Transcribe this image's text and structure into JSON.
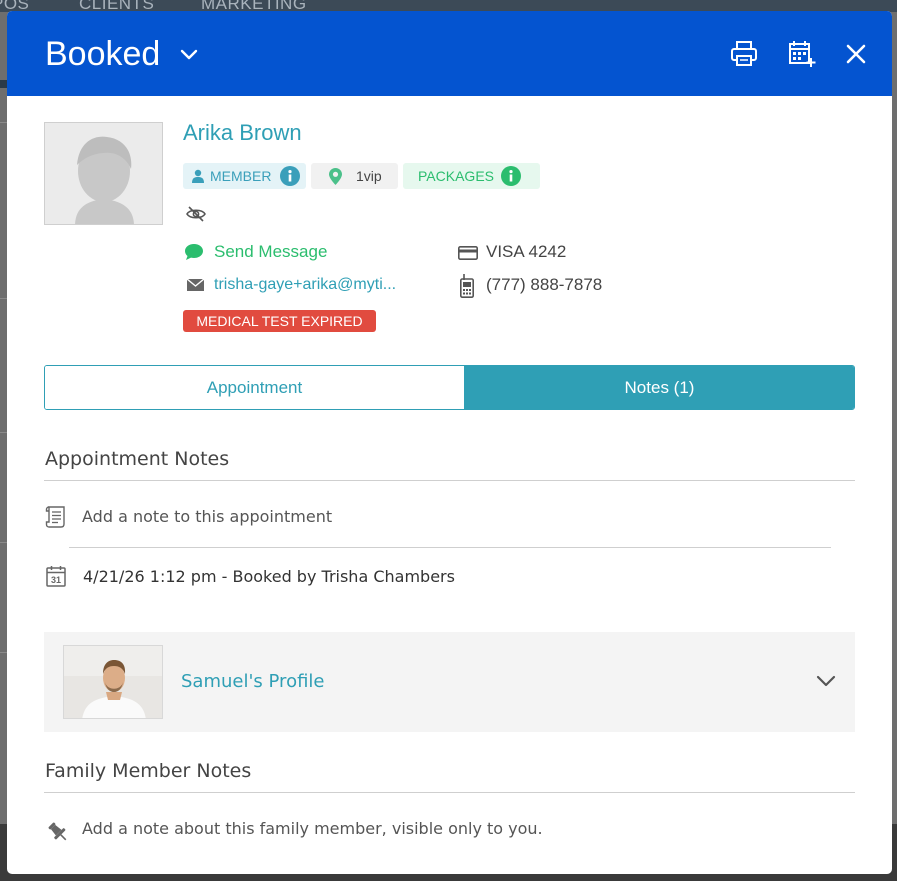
{
  "background_nav": {
    "items": [
      "POS",
      "CLIENTS",
      "MARKETING"
    ]
  },
  "header": {
    "status": "Booked",
    "icons": [
      "chevron-down-icon",
      "print-icon",
      "calendar-add-icon",
      "close-icon"
    ],
    "color": "#0454d0"
  },
  "client": {
    "name": "Arika Brown",
    "tags": {
      "member": "MEMBER",
      "location": "1vip",
      "packages": "PACKAGES"
    },
    "send_message": "Send Message",
    "email": "trisha-gaye+arika@myti...",
    "card": "VISA 4242",
    "phone": "(777) 888-7878",
    "alert": "MEDICAL TEST EXPIRED"
  },
  "tabs": {
    "appointment": "Appointment",
    "notes": "Notes (1)",
    "active": "notes"
  },
  "appointment_notes": {
    "title": "Appointment Notes",
    "placeholder": "Add a note to this appointment",
    "history_entry": "4/21/26 1:12 pm - Booked by Trisha Chambers",
    "calendar_day": "31"
  },
  "family_member": {
    "profile_label": "Samuel's Profile"
  },
  "family_notes": {
    "title": "Family Member Notes",
    "placeholder": "Add a note about this family member, visible only to you."
  },
  "colors": {
    "teal": "#2f9fb5",
    "green": "#2bbd6e",
    "alert_red": "#e14b3f"
  }
}
